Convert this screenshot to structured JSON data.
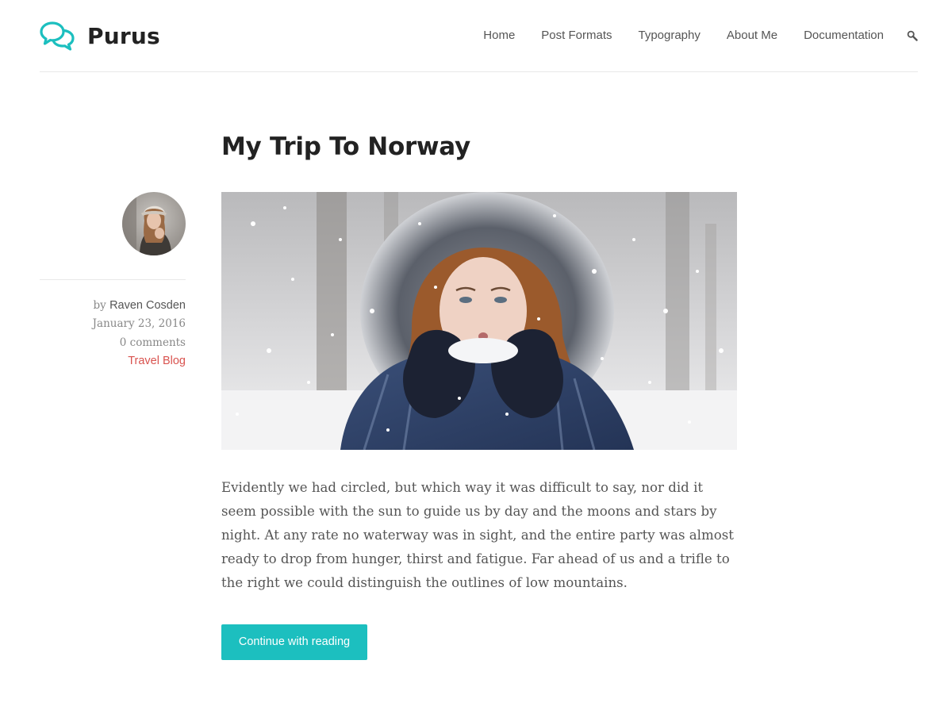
{
  "site": {
    "title": "Purus",
    "accent_color": "#1cbfbf",
    "logo_icon": "speech-bubbles-icon"
  },
  "nav": {
    "items": [
      {
        "label": "Home"
      },
      {
        "label": "Post Formats"
      },
      {
        "label": "Typography"
      },
      {
        "label": "About Me"
      },
      {
        "label": "Documentation"
      }
    ],
    "search_icon": "search-icon"
  },
  "post": {
    "title": "My Trip To Norway",
    "meta": {
      "by_prefix": "by",
      "author": "Raven Cosden",
      "date": "January 23, 2016",
      "comments": "0 comments",
      "category": "Travel Blog",
      "category_color": "#d9534f"
    },
    "excerpt": "Evidently we had circled, but which way it was difficult to say, nor did it seem possible with the sun to guide us by day and the moons and stars by night. At any rate no waterway was in sight, and the entire party was almost ready to drop from hunger, thirst and fatigue. Far ahead of us and a trifle to the right we could distinguish the outlines of low mountains.",
    "read_more_label": "Continue with reading"
  }
}
